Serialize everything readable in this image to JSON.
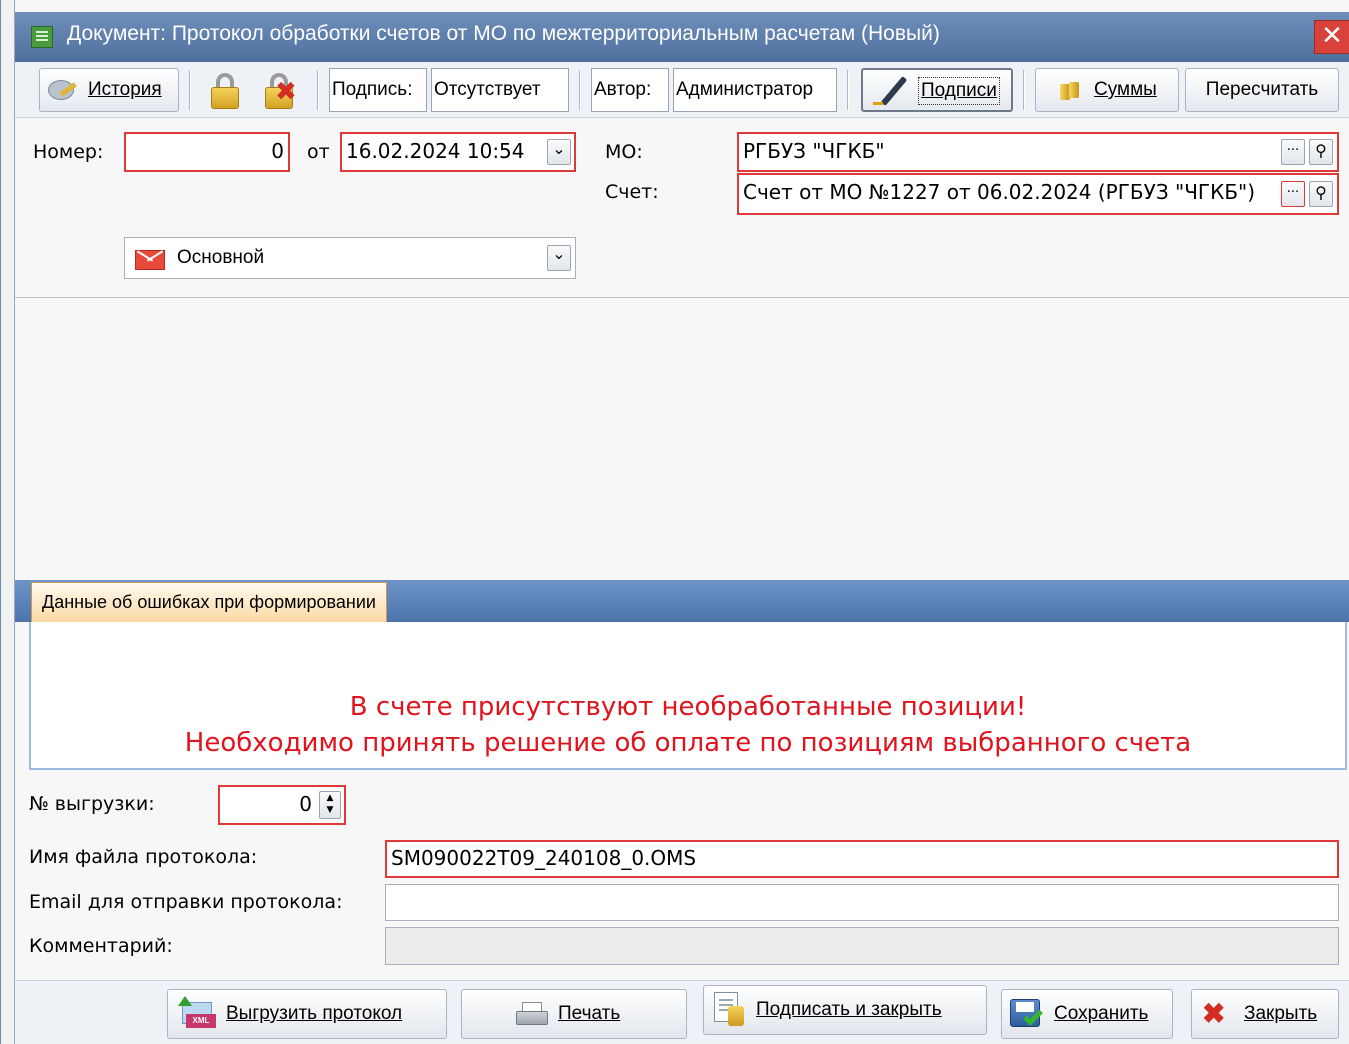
{
  "window": {
    "title": "Документ: Протокол обработки счетов от МО по межтерриториальным расчетам (Новый)",
    "close_symbol": "✕"
  },
  "toolbar": {
    "history_label": "История",
    "signature_label": "Подпись:",
    "signature_value": "Отсутствует",
    "author_label": "Автор:",
    "author_value": "Администратор",
    "signatures_label": "Подписи",
    "sums_label": "Суммы",
    "recalc_label": "Пересчитать"
  },
  "form": {
    "number_label": "Номер:",
    "number_value": "0",
    "from_label": "от",
    "date_value": "16.02.2024 10:54",
    "mo_label": "МО:",
    "mo_value": "РГБУЗ \"ЧГКБ\"",
    "invoice_label": "Счет:",
    "invoice_value": "Счет от МО №1227 от 06.02.2024 (РГБУЗ \"ЧГКБ\")",
    "type_value": "Основной",
    "ellipsis_glyph": "···",
    "dropdown_glyph": "⌄"
  },
  "tabs": {
    "errors_tab_label": "Данные об ошибках при формировании",
    "error_line1": "В счете присутствуют необработанные позиции!",
    "error_line2": "Необходимо принять решение об оплате по позициям выбранного счета"
  },
  "lower": {
    "export_no_label": "№ выгрузки:",
    "export_no_value": "0",
    "filename_label": "Имя файла протокола:",
    "filename_value": "SM090022T09_240108_0.OMS",
    "email_label": "Email для отправки протокола:",
    "email_value": "",
    "comment_label": "Комментарий:",
    "comment_value": ""
  },
  "buttons": {
    "export_label": "Выгрузить протокол",
    "xml_tag": "XML",
    "print_label": "Печать",
    "sign_close_label": "Подписать и закрыть",
    "save_label": "Сохранить",
    "close_label": "Закрыть"
  },
  "colors": {
    "title_bar": "#5b7bab",
    "required_border": "#e0393a",
    "error_text": "#e0141e",
    "tab_active": "#fbd9a3",
    "tab_strip": "#5a82b9"
  }
}
